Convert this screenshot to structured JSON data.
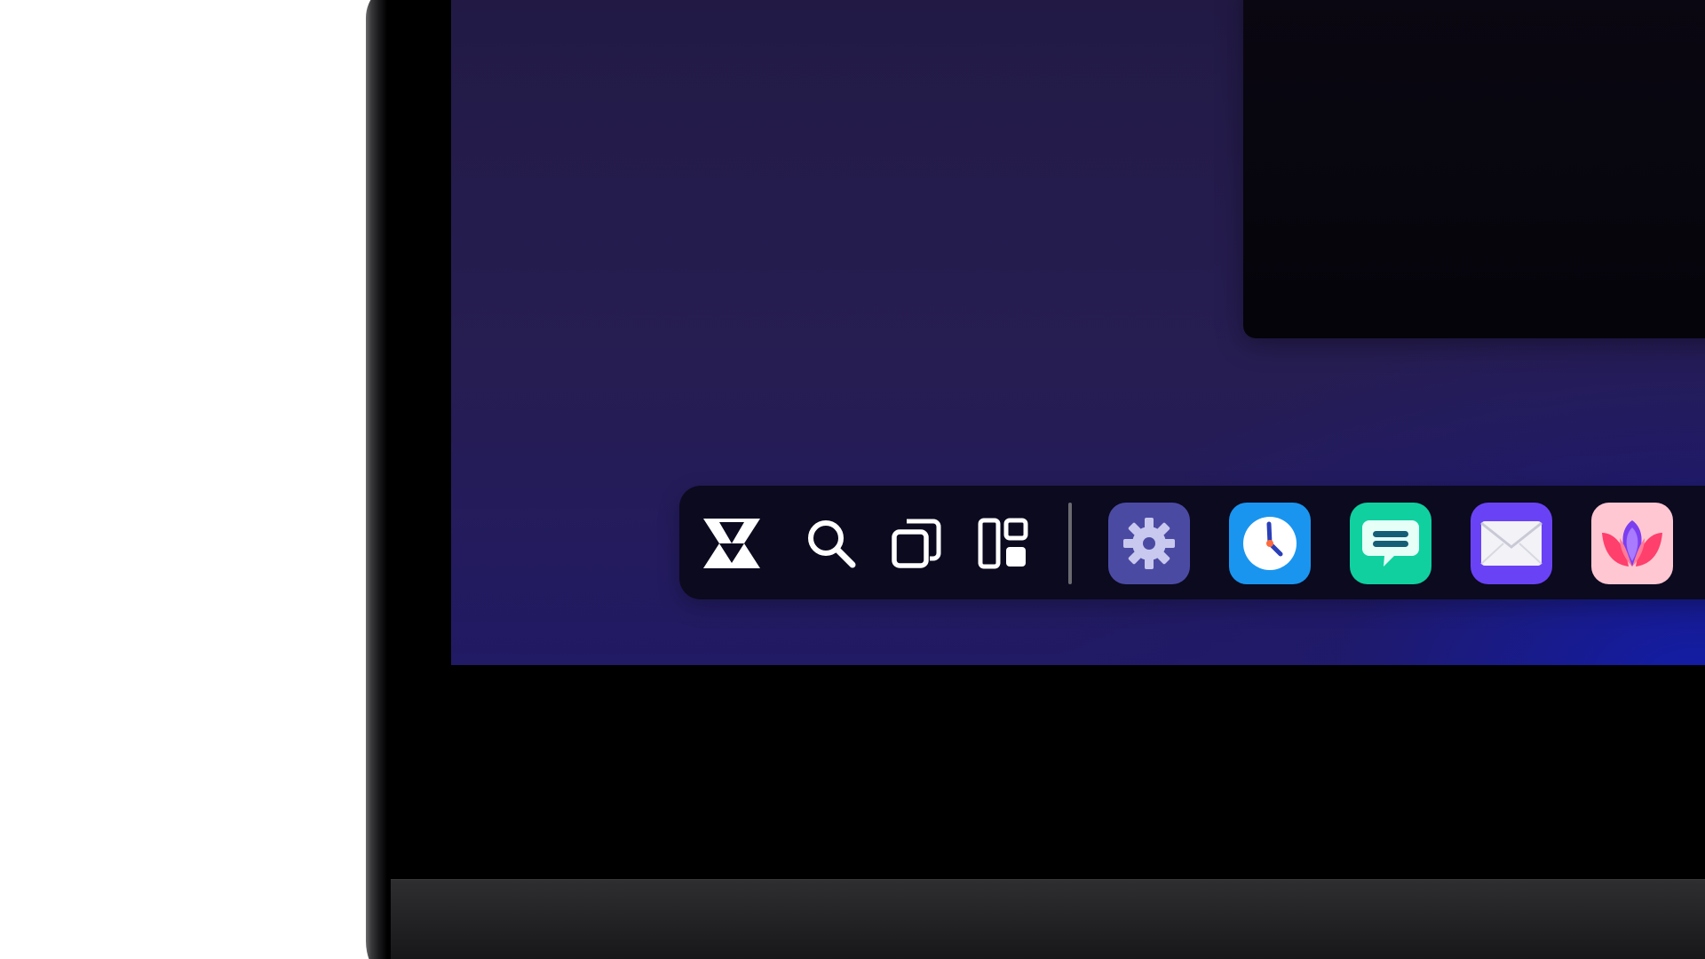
{
  "dock": {
    "launcher": {
      "icon": "launcher-logo-icon"
    },
    "search": {
      "icon": "search-icon"
    },
    "window_switcher": {
      "icon": "overlapping-windows-icon"
    },
    "layouts": {
      "icon": "tiled-layout-icon"
    },
    "apps": [
      {
        "id": "settings",
        "icon": "gear-icon",
        "color": "#4b4aa3"
      },
      {
        "id": "clock",
        "icon": "clock-icon",
        "color": "#1a95ef"
      },
      {
        "id": "messages",
        "icon": "chat-bubble-icon",
        "color": "#10d0a0"
      },
      {
        "id": "mail",
        "icon": "envelope-icon",
        "color": "#6a42f5"
      },
      {
        "id": "flower-app",
        "icon": "lotus-icon",
        "color": "#ffc7d2"
      }
    ]
  },
  "colors": {
    "dock_background": "#0b0a1f",
    "wallpaper_top": "#221a45",
    "wallpaper_glow": "#121caa",
    "window_background": "#05040a"
  }
}
